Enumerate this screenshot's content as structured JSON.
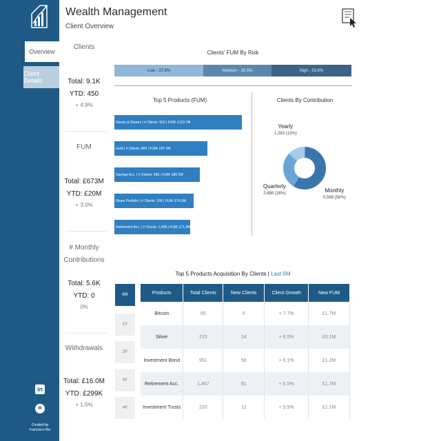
{
  "app": {
    "title": "Wealth Management",
    "subtitle": "Client Overview"
  },
  "sidebar": {
    "nav": [
      {
        "label": "Overview"
      },
      {
        "label": "Client Details"
      }
    ],
    "linkedin": "in",
    "medium": "M",
    "credit_line1": "Created by",
    "credit_line2": "Francisco Rei"
  },
  "kpis": [
    {
      "title": "Clients",
      "total": "Total: 9.1K",
      "ytd": "YTD: 450",
      "change": "+ 4.9%"
    },
    {
      "title": "FUM",
      "total": "Total: £673M",
      "ytd": "YTD: £20M",
      "change": "+ 3.0%"
    },
    {
      "title_line1": "# Monthly",
      "title_line2": "Contributions",
      "total": "Total: 5.6K",
      "ytd": "YTD: 0",
      "change": "0%"
    },
    {
      "title": "Withdrawals",
      "total": "Total: £16.0M",
      "ytd": "YTD: £299K",
      "change": "+ 1.5%"
    }
  ],
  "fum_by_risk": {
    "title": "Clients' FUM By Risk",
    "segments": [
      {
        "label": "Low - 37.6%",
        "share": 37.6,
        "color": "#8fb6db"
      },
      {
        "label": "Medium - 28.5%",
        "share": 28.5,
        "color": "#5b87ae"
      },
      {
        "label": "High - 33.8%",
        "share": 33.8,
        "color": "#3c6387"
      }
    ]
  },
  "top_products": {
    "title": "Top 5 Products (FUM)",
    "items": [
      {
        "label": "Stocks & Shares | # Clients: 933 | FUM: £119.7M",
        "fum": 119.7
      },
      {
        "label": "Gold | # Clients: 809 | FUM: £87.2M",
        "fum": 87.2
      },
      {
        "label": "Savings Acc. | # Clients: 856 | FUM: £80.2M",
        "fum": 80.2
      },
      {
        "label": "Share Portfolio | # Clients: 105 | FUM: £74.5M",
        "fum": 74.5
      },
      {
        "label": "Retirement Acc. | # Clients: 1,548 | FUM: £71.0M",
        "fum": 71.0
      }
    ]
  },
  "contribution": {
    "title": "Clients By Contribution",
    "slices": [
      {
        "name": "Yearly",
        "value": "1,283 (13%)",
        "share": 13,
        "color": "#a9cbe8"
      },
      {
        "name": "Quarterly",
        "value": "2,688 (28%)",
        "share": 28,
        "color": "#6aa5d6"
      },
      {
        "name": "Monthly",
        "value": "5,589 (58%)",
        "share": 58,
        "color": "#3a76ad"
      }
    ]
  },
  "acquisition": {
    "title": "Top 5 Products Acquisition By Clients |",
    "period_label": "Last 6M",
    "periods": [
      "6M",
      "1Y",
      "2Y",
      "3Y",
      "4Y"
    ],
    "columns": [
      "Products",
      "Total Clients",
      "New Clients",
      "Client Growth",
      "New FUM"
    ],
    "rows": [
      [
        "Bitcoin",
        "65",
        "5",
        "+ 7.7%",
        "£1.7M"
      ],
      [
        "Silver",
        "215",
        "14",
        "+ 6.5%",
        "£0.1M"
      ],
      [
        "Investment Bond",
        "951",
        "58",
        "+ 6.1%",
        "£1.2M"
      ],
      [
        "Retirement Acc.",
        "1,467",
        "81",
        "+ 5.5%",
        "£1.7M"
      ],
      [
        "Investment Trusts",
        "220",
        "12",
        "+ 5.5%",
        "£1.1M"
      ]
    ]
  }
}
